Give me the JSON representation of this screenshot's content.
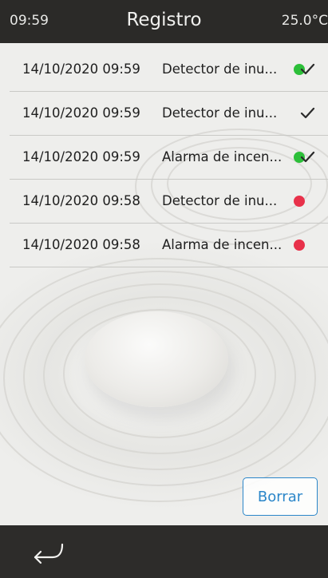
{
  "status_bar": {
    "time": "09:59",
    "title": "Registro",
    "temperature": "25.0°C"
  },
  "log": {
    "rows": [
      {
        "date": "14/10/2020 09:59",
        "description": "Detector de inu...",
        "status": "green-dot-check"
      },
      {
        "date": "14/10/2020 09:59",
        "description": "Detector de inu...",
        "status": "check"
      },
      {
        "date": "14/10/2020 09:59",
        "description": "Alarma de incen...",
        "status": "green-dot-check"
      },
      {
        "date": "14/10/2020 09:58",
        "description": "Detector de inu...",
        "status": "red-dot"
      },
      {
        "date": "14/10/2020 09:58",
        "description": "Alarma de incen...",
        "status": "red-dot"
      }
    ]
  },
  "actions": {
    "clear_label": "Borrar"
  },
  "icons": {
    "back": "back-arrow-icon",
    "check": "check-icon",
    "green_dot": "green-dot-icon",
    "red_dot": "red-dot-icon"
  },
  "colors": {
    "bar_background": "#2b2a28",
    "accent": "#2b86c9",
    "status_ok": "#2cbf39",
    "status_alarm": "#e8314a"
  }
}
